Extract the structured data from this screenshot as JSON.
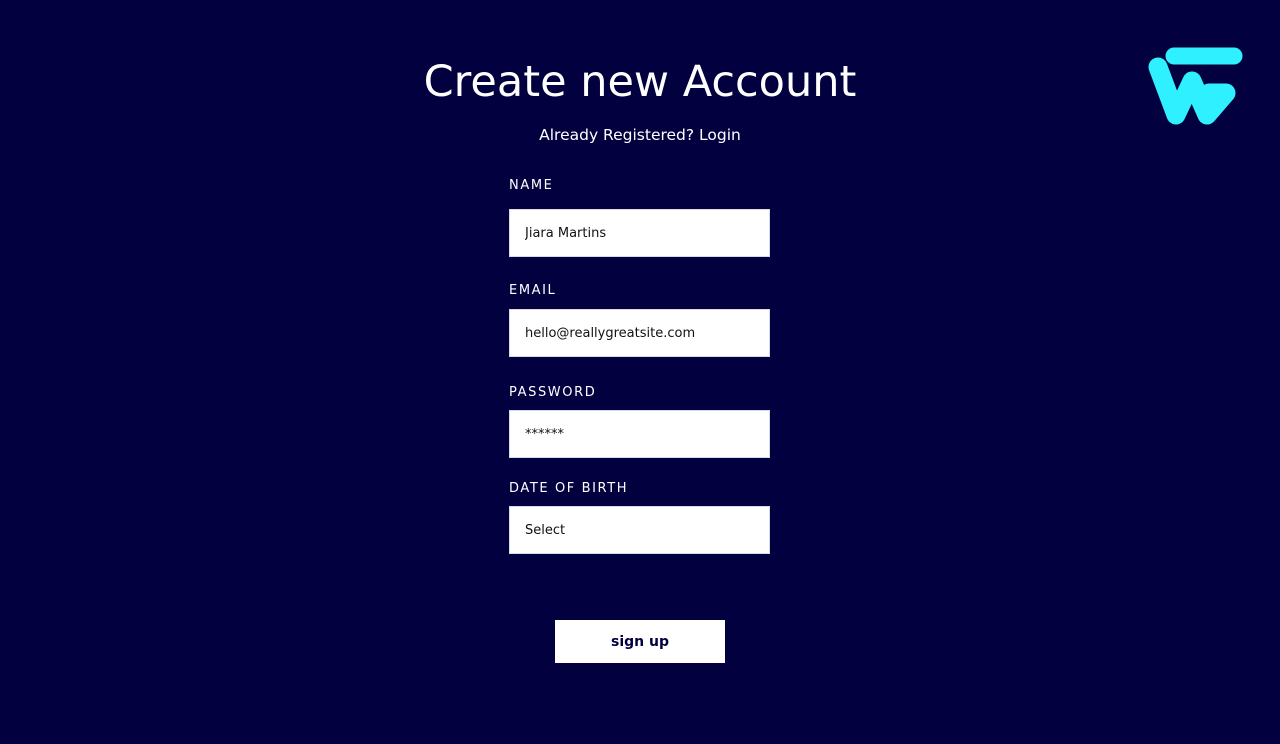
{
  "page": {
    "title": "Create new Account",
    "login_prompt": "Already Registered? Login"
  },
  "form": {
    "name": {
      "label": "NAME",
      "value": "Jiara Martins"
    },
    "email": {
      "label": "EMAIL",
      "value": "hello@reallygreatsite.com"
    },
    "password": {
      "label": "PASSWORD",
      "value": "******"
    },
    "date_of_birth": {
      "label": "DATE OF BIRTH",
      "selected": "Select"
    },
    "submit_label": "sign up"
  },
  "logo": {
    "icon": "w-g-monogram-logo",
    "color": "#2ef0ff"
  },
  "colors": {
    "background": "#02003f",
    "text": "#ffffff",
    "field_background": "#ffffff",
    "button_text": "#02003f"
  }
}
